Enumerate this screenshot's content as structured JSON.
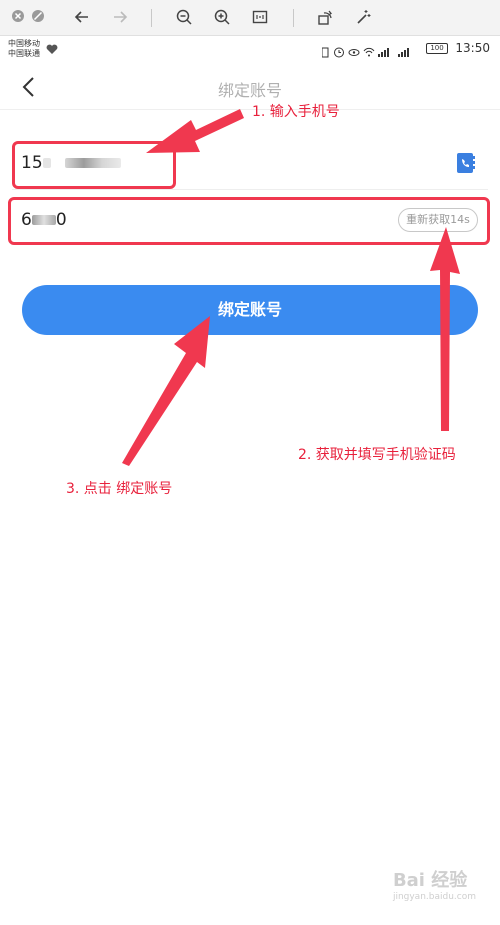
{
  "status_bar": {
    "carrier_1": "中国移动",
    "carrier_2": "中国联通",
    "battery": "100",
    "time": "13:50"
  },
  "nav": {
    "title": "绑定账号"
  },
  "form": {
    "phone_value": "15",
    "code_value": "6",
    "code_value_end": "0",
    "resend_label": "重新获取14s",
    "submit_label": "绑定账号"
  },
  "annotations": {
    "step1": "1. 输入手机号",
    "step2": "2. 获取并填写手机验证码",
    "step3": "3. 点击 绑定账号",
    "color": "#e8213c"
  },
  "watermark": {
    "main": "Bai 经验",
    "sub": "jingyan.baidu.com"
  },
  "colors": {
    "primary_button": "#3a8bf0",
    "title_gray": "#b0b0b0",
    "annotation_red": "#f0384f"
  }
}
